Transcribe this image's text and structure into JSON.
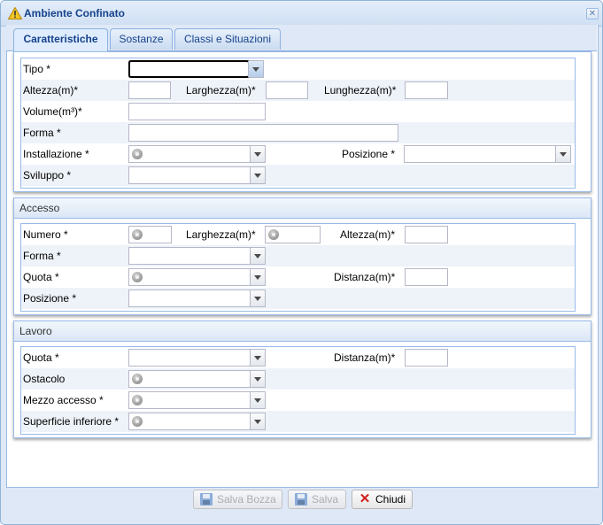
{
  "window": {
    "title": "Ambiente Confinato",
    "title_icon": "warning-icon",
    "close_icon": "close-icon"
  },
  "tabs": [
    {
      "label": "Caratteristiche",
      "active": true
    },
    {
      "label": "Sostanze",
      "active": false
    },
    {
      "label": "Classi e Situazioni",
      "active": false
    }
  ],
  "caratteristiche": {
    "tipo": {
      "label": "Tipo *",
      "value": ""
    },
    "altezza": {
      "label": "Altezza(m)*",
      "value": ""
    },
    "larghezza": {
      "label": "Larghezza(m)*",
      "value": ""
    },
    "lunghezza": {
      "label": "Lunghezza(m)*",
      "value": ""
    },
    "volume": {
      "label": "Volume(m³)*",
      "value": ""
    },
    "forma": {
      "label": "Forma *",
      "value": ""
    },
    "installazione": {
      "label": "Installazione *",
      "value": ""
    },
    "posizione": {
      "label": "Posizione *",
      "value": ""
    },
    "sviluppo": {
      "label": "Sviluppo *",
      "value": ""
    }
  },
  "accesso": {
    "title": "Accesso",
    "numero": {
      "label": "Numero *",
      "value": ""
    },
    "larghezza": {
      "label": "Larghezza(m)*",
      "value": ""
    },
    "altezza": {
      "label": "Altezza(m)*",
      "value": ""
    },
    "forma": {
      "label": "Forma *",
      "value": ""
    },
    "quota": {
      "label": "Quota *",
      "value": ""
    },
    "distanza": {
      "label": "Distanza(m)*",
      "value": ""
    },
    "posizione": {
      "label": "Posizione *",
      "value": ""
    }
  },
  "lavoro": {
    "title": "Lavoro",
    "quota": {
      "label": "Quota *",
      "value": ""
    },
    "distanza": {
      "label": "Distanza(m)*",
      "value": ""
    },
    "ostacolo": {
      "label": "Ostacolo",
      "value": ""
    },
    "mezzo_accesso": {
      "label": "Mezzo accesso *",
      "value": ""
    },
    "superficie_inferiore": {
      "label": "Superficie inferiore *",
      "value": ""
    }
  },
  "footer": {
    "salva_bozza": {
      "label": "Salva Bozza",
      "enabled": false,
      "icon": "save-icon"
    },
    "salva": {
      "label": "Salva",
      "enabled": false,
      "icon": "save-icon"
    },
    "chiudi": {
      "label": "Chiudi",
      "enabled": true,
      "icon": "close-red-icon"
    }
  }
}
